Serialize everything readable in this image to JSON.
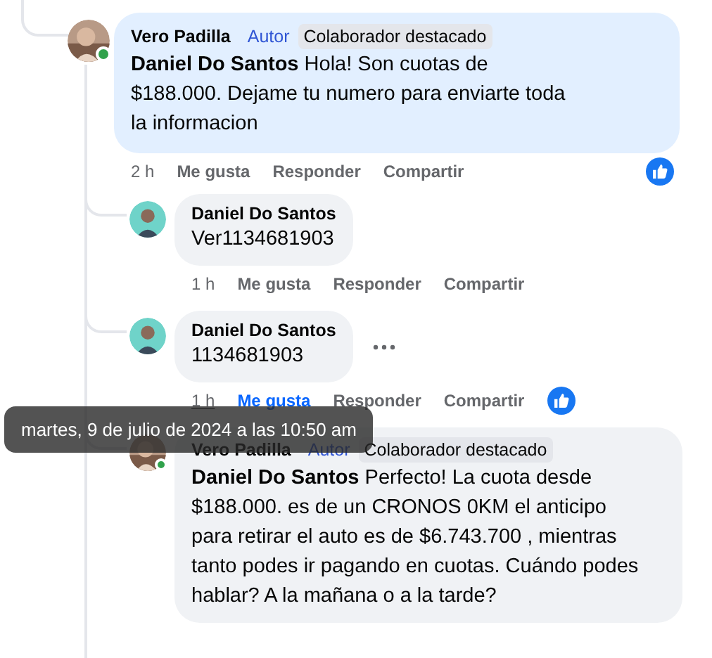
{
  "comment": {
    "author": "Vero Padilla",
    "online": true,
    "highlighted": true,
    "badges": [
      {
        "text": "Autor",
        "kind": "role"
      },
      {
        "text": "Colaborador destacado",
        "kind": "tag"
      }
    ],
    "mention": "Daniel Do Santos",
    "text": "Hola! Son cuotas de $188.000. Dejame tu numero para enviarte toda la informacion",
    "time": "2 h",
    "actions": [
      "Me gusta",
      "Responder",
      "Compartir"
    ],
    "liked": false,
    "reaction": true,
    "children": [
      {
        "author": "Daniel Do Santos",
        "highlighted": false,
        "text": "Ver1134681903",
        "time": "1 h",
        "time_hovered": false,
        "actions": [
          "Me gusta",
          "Responder",
          "Compartir"
        ],
        "liked": false
      },
      {
        "author": "Daniel Do Santos",
        "highlighted": false,
        "text": "1134681903",
        "time": "1 h",
        "time_hovered": true,
        "tooltip": "martes, 9 de julio de 2024 a las 10:50 am",
        "actions": [
          "Me gusta",
          "Responder",
          "Compartir"
        ],
        "liked": true,
        "reaction": true,
        "more": true
      },
      {
        "author": "Vero Padilla",
        "online": true,
        "highlighted": false,
        "badges": [
          {
            "text": "Autor",
            "kind": "role"
          },
          {
            "text": "Colaborador destacado",
            "kind": "tag"
          }
        ],
        "mention": "Daniel Do Santos",
        "text": "Perfecto! La cuota desde $188.000. es de un CRONOS 0KM el anticipo para retirar el auto es de $6.743.700 , mientras tanto podes ir pagando en cuotas. Cuándo podes hablar? A la mañana o a la tarde?"
      }
    ]
  }
}
